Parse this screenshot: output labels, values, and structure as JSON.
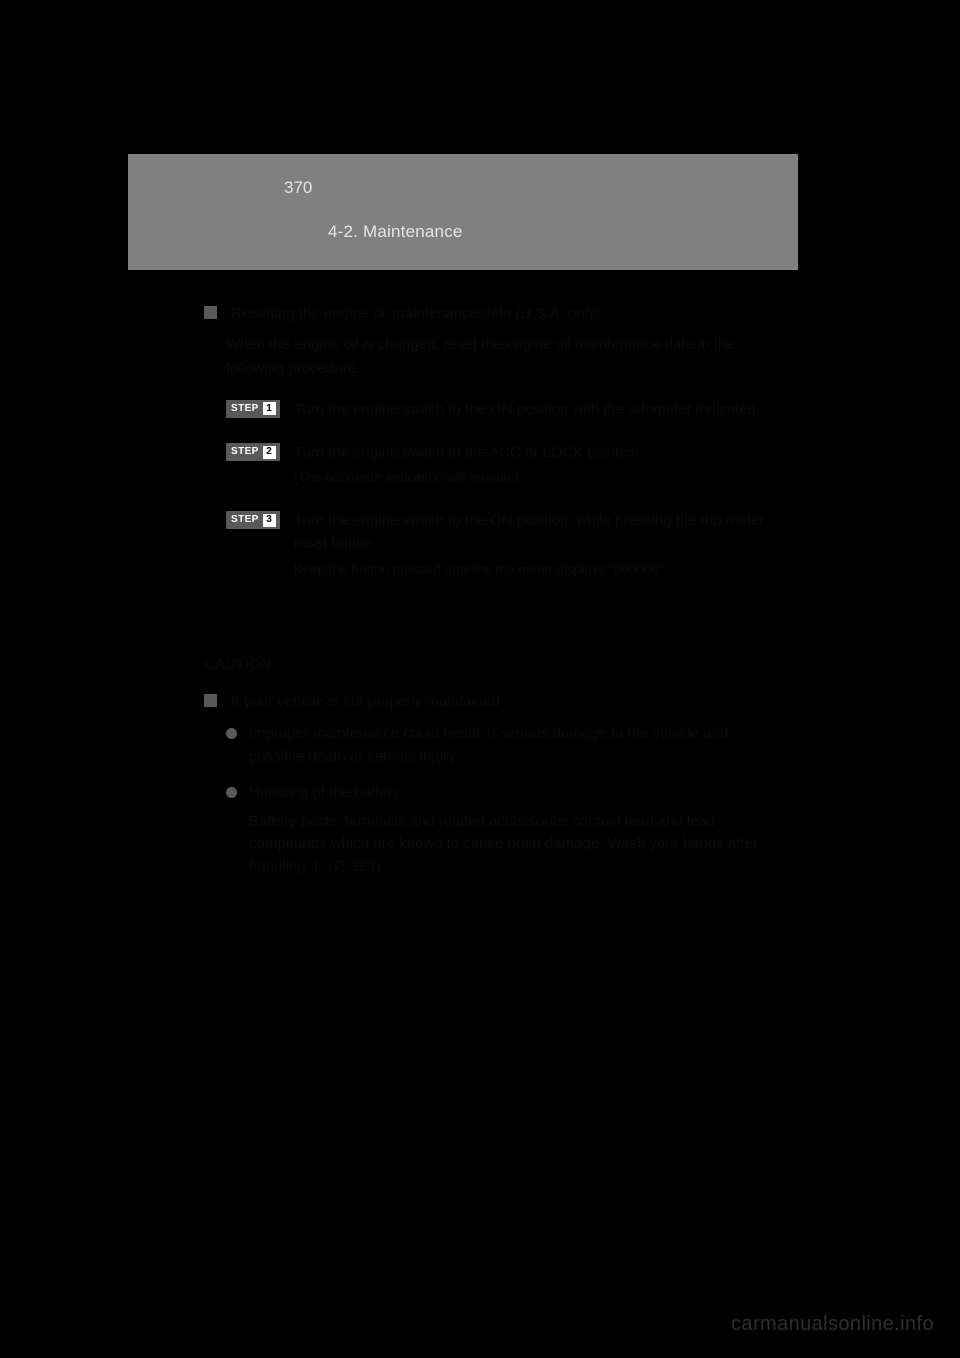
{
  "header": {
    "page_number": "370",
    "section": "4-2. Maintenance"
  },
  "block1": {
    "heading": "Resetting the engine oil maintenance data (U.S.A. only)",
    "intro": "When the engine oil is changed, reset the engine oil maintenance data in the following procedure.",
    "steps": [
      {
        "label": "STEP",
        "num": "1",
        "text": "Turn the engine switch to the ON position with the odometer indicated."
      },
      {
        "label": "STEP",
        "num": "2",
        "text": "Turn the engine switch to the ACC or LOCK position.",
        "sub": "(The odometer indication will remain.)"
      },
      {
        "label": "STEP",
        "num": "3",
        "text": "Turn the engine switch to the ON position, while pressing the trip meter reset button.",
        "sub": "Keep the button pressed until the trip meter displays \"000000\"."
      }
    ]
  },
  "caution": {
    "label": "CAUTION",
    "heading": "If your vehicle is not properly maintained",
    "items": [
      "Improper maintenance could result in serious damage to the vehicle and possible death or serious injury.",
      "Handling of the battery",
      "Battery posts, terminals and related accessories contain lead and lead compounds which are known to cause brain damage.  Wash your hands after handling. (→P. 393)"
    ]
  },
  "watermark": "carmanualsonline.info"
}
